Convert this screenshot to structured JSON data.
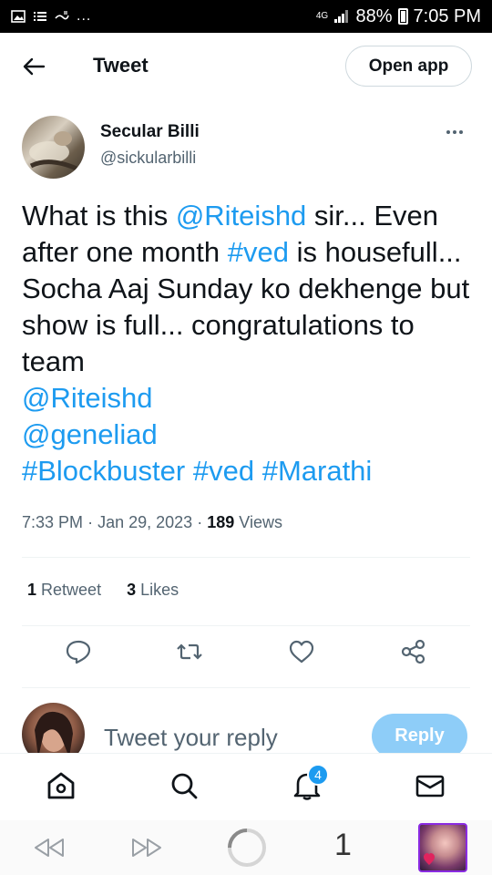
{
  "status_bar": {
    "network": "4G",
    "battery": "88%",
    "time": "7:05 PM",
    "dots": "..."
  },
  "header": {
    "title": "Tweet",
    "open_app_label": "Open app"
  },
  "author": {
    "name": "Secular Billi",
    "handle": "@sickularbilli"
  },
  "tweet": {
    "segments": [
      {
        "text": "What is this ",
        "link": false
      },
      {
        "text": "@Riteishd",
        "link": true
      },
      {
        "text": " sir... Even after one month ",
        "link": false
      },
      {
        "text": "#ved",
        "link": true
      },
      {
        "text": " is housefull... Socha Aaj Sunday ko dekhenge but show is full... congratulations to team ",
        "link": false
      },
      {
        "text": "@Riteishd",
        "link": true,
        "break_before": true
      },
      {
        "text": "@geneliad",
        "link": true,
        "break_before": true
      },
      {
        "text": "#Blockbuster",
        "link": true,
        "break_before": true
      },
      {
        "text": " ",
        "link": false
      },
      {
        "text": "#ved",
        "link": true
      },
      {
        "text": " ",
        "link": false
      },
      {
        "text": "#Marathi",
        "link": true
      }
    ],
    "time": "7:33 PM",
    "date": "Jan 29, 2023",
    "views_count": "189",
    "views_label": "Views",
    "separator": "·"
  },
  "stats": {
    "retweets_count": "1",
    "retweets_label": "Retweet",
    "likes_count": "3",
    "likes_label": "Likes"
  },
  "actions": {
    "icons": [
      "reply-icon",
      "retweet-icon",
      "like-icon",
      "share-icon"
    ]
  },
  "reply": {
    "placeholder": "Tweet your reply",
    "button_label": "Reply"
  },
  "bottom_nav": {
    "icons": [
      "home-icon",
      "search-icon",
      "notifications-icon",
      "messages-icon"
    ],
    "notification_badge": "4"
  },
  "browser_bar": {
    "tab_count": "1"
  },
  "colors": {
    "link": "#1d9bf0",
    "reply_button": "#8ecdf8",
    "secondary_text": "#536471"
  }
}
